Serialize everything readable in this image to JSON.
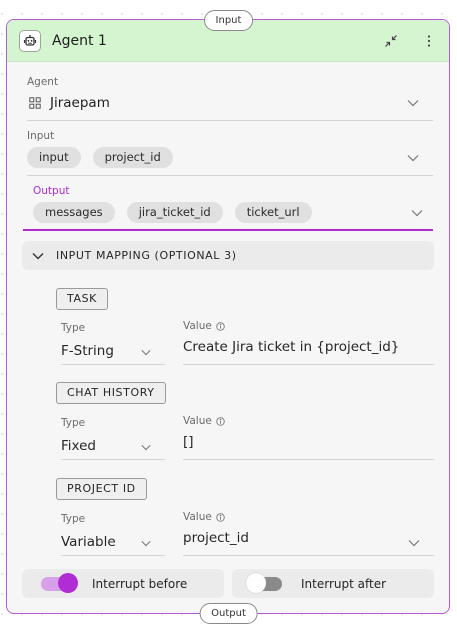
{
  "handles": {
    "input": "Input",
    "output": "Output"
  },
  "node": {
    "title": "Agent 1",
    "colors": {
      "border": "#b45bd6",
      "header_bg": "#d4f5cf",
      "accent": "#b02dd4"
    }
  },
  "agent_field": {
    "label": "Agent",
    "value": "Jiraepam"
  },
  "input_field": {
    "label": "Input",
    "chips": [
      "input",
      "project_id"
    ]
  },
  "output_field": {
    "label": "Output",
    "chips": [
      "messages",
      "jira_ticket_id",
      "ticket_url"
    ]
  },
  "mapping": {
    "title": "INPUT MAPPING (OPTIONAL 3)",
    "groups": [
      {
        "tag": "TASK",
        "type_label": "Type",
        "type_value": "F-String",
        "value_label": "Value",
        "value": "Create Jira ticket in {project_id}"
      },
      {
        "tag": "CHAT HISTORY",
        "type_label": "Type",
        "type_value": "Fixed",
        "value_label": "Value",
        "value": "[]"
      },
      {
        "tag": "PROJECT ID",
        "type_label": "Type",
        "type_value": "Variable",
        "value_label": "Value",
        "value": "project_id"
      }
    ]
  },
  "toggles": {
    "interrupt_before": {
      "label": "Interrupt before",
      "on": true
    },
    "interrupt_after": {
      "label": "Interrupt after",
      "on": false
    }
  },
  "icons": [
    "robot-icon",
    "collapse-icon",
    "more-vertical-icon",
    "grid-icon",
    "chevron-down-icon",
    "info-icon"
  ]
}
